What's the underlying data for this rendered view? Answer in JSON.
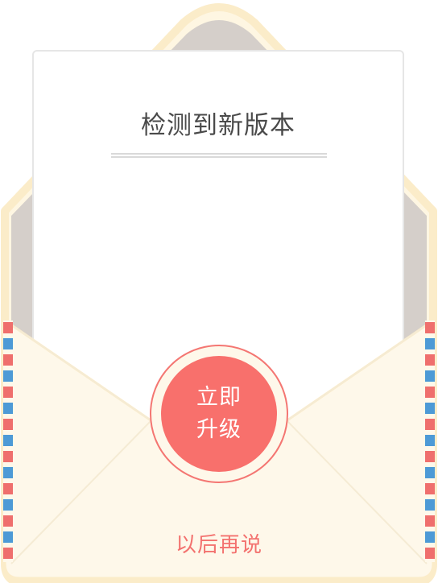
{
  "dialog": {
    "title": "检测到新版本",
    "upgrade_button": {
      "line1": "立即",
      "line2": "升级"
    },
    "later_link": "以后再说"
  },
  "colors": {
    "accent": "#f8706c",
    "envelope_body": "#fef8ea",
    "envelope_border": "#fbecc9",
    "envelope_inner": "#d5cfca",
    "airmail_red": "#ef6f6d",
    "airmail_blue": "#4d9ad6",
    "title_text": "#4a4a4a"
  },
  "icons": {
    "envelope": "airmail-envelope-illustration"
  }
}
